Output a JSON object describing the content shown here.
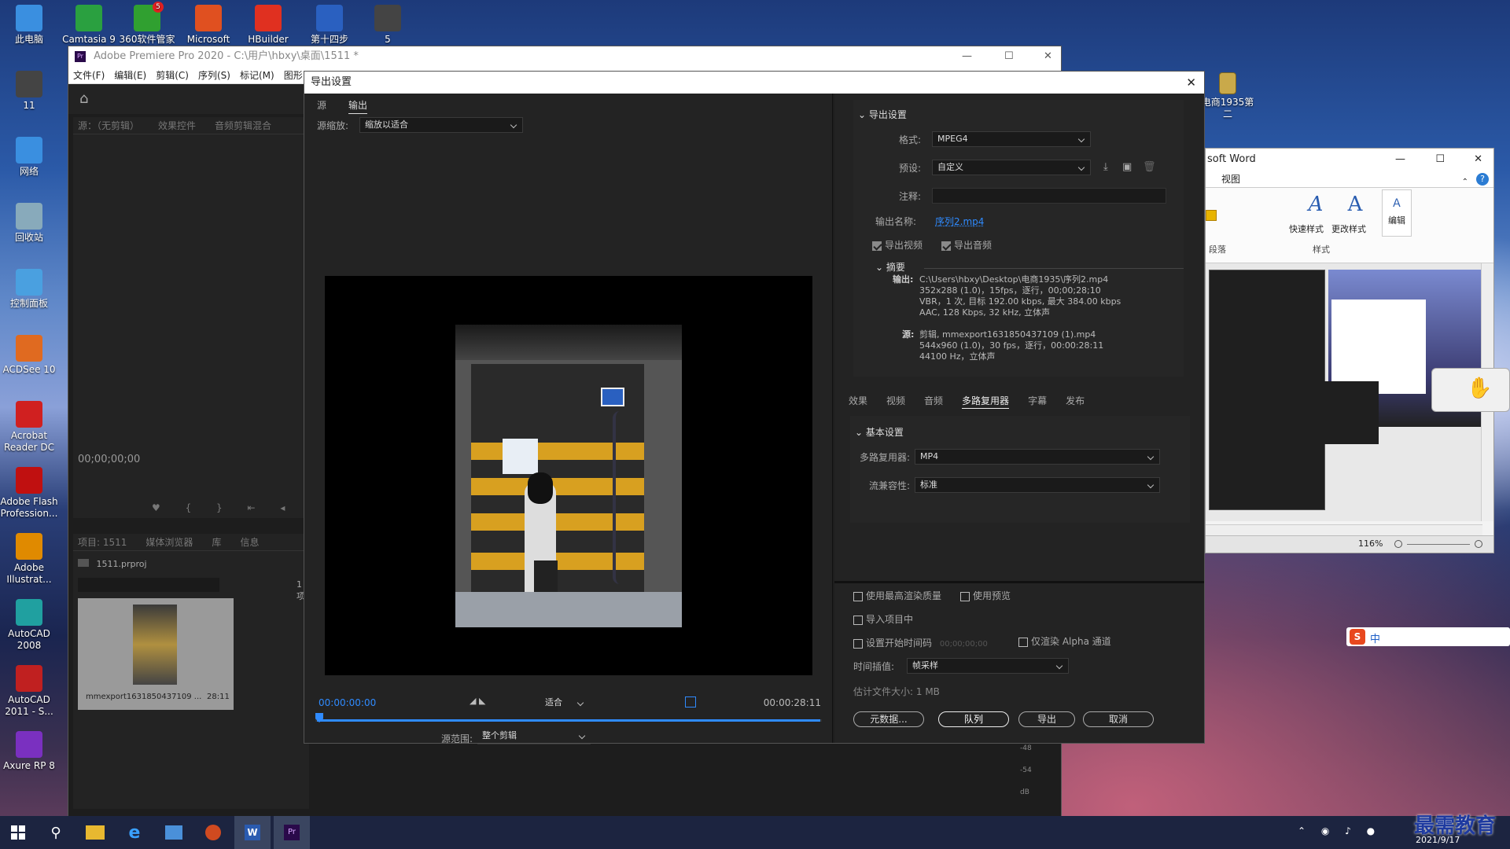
{
  "desktop_icons": [
    {
      "label": "此电脑",
      "color": "#3a8fe0",
      "icon": "computer-icon"
    },
    {
      "label": "11",
      "color": "#444",
      "icon": "device-icon"
    },
    {
      "label": "网络",
      "color": "#3a8fe0",
      "icon": "network-icon"
    },
    {
      "label": "回收站",
      "color": "#8ab",
      "icon": "recycle-bin-icon"
    },
    {
      "label": "控制面板",
      "color": "#4aa0e0",
      "icon": "control-panel-icon"
    },
    {
      "label": "ACDSee 10",
      "color": "#e06a20",
      "icon": "acdsee-icon"
    },
    {
      "label": "Acrobat Reader DC",
      "color": "#d02020",
      "icon": "acrobat-icon"
    },
    {
      "label": "Adobe Flash Profession...",
      "color": "#c01010",
      "icon": "flash-icon"
    },
    {
      "label": "Adobe Illustrat...",
      "color": "#e08a00",
      "icon": "illustrator-icon"
    },
    {
      "label": "AutoCAD 2008",
      "color": "#20a0a0",
      "icon": "autocad-icon"
    },
    {
      "label": "AutoCAD 2011 - S...",
      "color": "#c02020",
      "icon": "autocad-2011-icon"
    },
    {
      "label": "Axure RP 8",
      "color": "#7a30c0",
      "icon": "axure-icon"
    }
  ],
  "top_icons": [
    {
      "label": "Camtasia 9",
      "color": "#2aa040",
      "icon": "camtasia-icon"
    },
    {
      "label": "360软件管家",
      "color": "#30a030",
      "icon": "360-icon",
      "badge": "5"
    },
    {
      "label": "Microsoft",
      "color": "#e05020",
      "icon": "powerpoint-icon"
    },
    {
      "label": "HBuilder",
      "color": "#e03020",
      "icon": "hbuilder-icon"
    },
    {
      "label": "第十四步",
      "color": "#2a60c0",
      "icon": "word-doc-icon"
    },
    {
      "label": "5",
      "color": "#444",
      "icon": "device-icon"
    }
  ],
  "desktop_right_icon": {
    "label": "电商1935第二",
    "icon": "folder-icon"
  },
  "premiere": {
    "title": "Adobe Premiere Pro 2020 - C:\\用户\\hbxy\\桌面\\1511 *",
    "menu": [
      "文件(F)",
      "编辑(E)",
      "剪辑(C)",
      "序列(S)",
      "标记(M)",
      "图形"
    ],
    "source_tabs": [
      "源：（无剪辑）",
      "效果控件",
      "音频剪辑混合"
    ],
    "timecode": "00;00;00;00",
    "project_tabs": [
      "项目: 1511",
      "媒体浏览器",
      "库",
      "信息"
    ],
    "project_file": "1511.prproj",
    "item_count": "1 项",
    "clip_name": "mmexport1631850437109 ...",
    "clip_duration": "28:11",
    "meter_labels": [
      "-48",
      "-54",
      "dB"
    ]
  },
  "word": {
    "title": "soft Word",
    "tab": "视图",
    "styles": [
      "快速样式",
      "更改样式"
    ],
    "edit": "编辑",
    "group_para": "段落",
    "group_style": "样式",
    "zoom": "116%"
  },
  "export_dialog": {
    "title": "导出设置",
    "tabs": [
      "源",
      "输出"
    ],
    "source_scale_label": "源缩放:",
    "source_scale_value": "缩放以适合",
    "timecode_in": "00:00:00:00",
    "fit_value": "适合",
    "timecode_out": "00:00:28:11",
    "source_range_label": "源范围:",
    "source_range_value": "整个剪辑",
    "playhead_fraction": 0,
    "export_settings_header": "导出设置",
    "format_label": "格式:",
    "format_value": "MPEG4",
    "preset_label": "预设:",
    "preset_value": "自定义",
    "comment_label": "注释:",
    "comment_value": "",
    "output_name_label": "输出名称:",
    "output_name_value": "序列2.mp4",
    "export_video_label": "导出视频",
    "export_audio_label": "导出音频",
    "summary_header": "摘要",
    "output_label": "输出:",
    "output_lines": [
      "C:\\Users\\hbxy\\Desktop\\电商1935\\序列2.mp4",
      "352x288 (1.0)，15fps，逐行，00;00;28;10",
      "VBR，1 次, 目标 192.00 kbps, 最大 384.00 kbps",
      "AAC, 128 Kbps, 32  kHz, 立体声"
    ],
    "source_label": "源:",
    "source_lines": [
      "剪辑, mmexport1631850437109 (1).mp4",
      "544x960 (1.0)，30 fps，逐行，00:00:28:11",
      "44100 Hz，立体声"
    ],
    "settings_tabs": [
      "效果",
      "视频",
      "音频",
      "多路复用器",
      "字幕",
      "发布"
    ],
    "basic_settings_header": "基本设置",
    "multiplexer_label": "多路复用器:",
    "multiplexer_value": "MP4",
    "stream_compat_label": "流兼容性:",
    "stream_compat_value": "标准",
    "max_render_label": "使用最高渲染质量",
    "use_preview_label": "使用预览",
    "import_project_label": "导入项目中",
    "set_start_tc_label": "设置开始时间码",
    "start_tc_value": "00;00;00;00",
    "alpha_only_label": "仅渲染 Alpha 通道",
    "time_interp_label": "时间插值:",
    "time_interp_value": "帧采样",
    "est_size_label": "估计文件大小:",
    "est_size_value": "1 MB",
    "metadata_button": "元数据...",
    "queue_button": "队列",
    "export_button": "导出",
    "cancel_button": "取消"
  },
  "taskbar": {
    "date": "2021/9/17",
    "watermark": "最需教育",
    "tray": "中"
  }
}
